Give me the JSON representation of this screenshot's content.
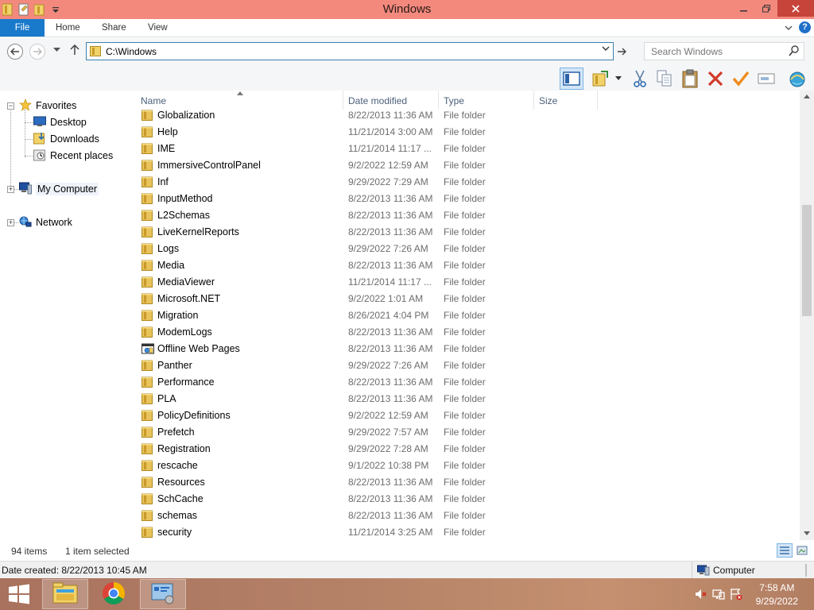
{
  "window": {
    "title": "Windows"
  },
  "ribbon": {
    "tabs": [
      "File",
      "Home",
      "Share",
      "View"
    ]
  },
  "address": {
    "path": "C:\\Windows",
    "search_placeholder": "Search Windows"
  },
  "nav_pane": {
    "favorites": "Favorites",
    "desktop": "Desktop",
    "downloads": "Downloads",
    "recent": "Recent places",
    "computer": "My Computer",
    "network": "Network"
  },
  "columns": {
    "name": "Name",
    "date": "Date modified",
    "type": "Type",
    "size": "Size"
  },
  "files": [
    {
      "name": "Globalization",
      "date": "8/22/2013 11:36 AM",
      "type": "File folder",
      "icon": "folder-icon"
    },
    {
      "name": "Help",
      "date": "11/21/2014 3:00 AM",
      "type": "File folder",
      "icon": "folder-icon"
    },
    {
      "name": "IME",
      "date": "11/21/2014 11:17 ...",
      "type": "File folder",
      "icon": "folder-icon"
    },
    {
      "name": "ImmersiveControlPanel",
      "date": "9/2/2022 12:59 AM",
      "type": "File folder",
      "icon": "folder-icon"
    },
    {
      "name": "Inf",
      "date": "9/29/2022 7:29 AM",
      "type": "File folder",
      "icon": "folder-icon"
    },
    {
      "name": "InputMethod",
      "date": "8/22/2013 11:36 AM",
      "type": "File folder",
      "icon": "folder-icon"
    },
    {
      "name": "L2Schemas",
      "date": "8/22/2013 11:36 AM",
      "type": "File folder",
      "icon": "folder-icon"
    },
    {
      "name": "LiveKernelReports",
      "date": "8/22/2013 11:36 AM",
      "type": "File folder",
      "icon": "folder-icon"
    },
    {
      "name": "Logs",
      "date": "9/29/2022 7:26 AM",
      "type": "File folder",
      "icon": "folder-icon"
    },
    {
      "name": "Media",
      "date": "8/22/2013 11:36 AM",
      "type": "File folder",
      "icon": "folder-icon"
    },
    {
      "name": "MediaViewer",
      "date": "11/21/2014 11:17 ...",
      "type": "File folder",
      "icon": "folder-icon"
    },
    {
      "name": "Microsoft.NET",
      "date": "9/2/2022 1:01 AM",
      "type": "File folder",
      "icon": "folder-icon"
    },
    {
      "name": "Migration",
      "date": "8/26/2021 4:04 PM",
      "type": "File folder",
      "icon": "folder-icon"
    },
    {
      "name": "ModemLogs",
      "date": "8/22/2013 11:36 AM",
      "type": "File folder",
      "icon": "folder-icon"
    },
    {
      "name": "Offline Web Pages",
      "date": "8/22/2013 11:36 AM",
      "type": "File folder",
      "icon": "offline-web-pages-icon"
    },
    {
      "name": "Panther",
      "date": "9/29/2022 7:26 AM",
      "type": "File folder",
      "icon": "folder-icon"
    },
    {
      "name": "Performance",
      "date": "8/22/2013 11:36 AM",
      "type": "File folder",
      "icon": "folder-icon"
    },
    {
      "name": "PLA",
      "date": "8/22/2013 11:36 AM",
      "type": "File folder",
      "icon": "folder-icon"
    },
    {
      "name": "PolicyDefinitions",
      "date": "9/2/2022 12:59 AM",
      "type": "File folder",
      "icon": "folder-icon"
    },
    {
      "name": "Prefetch",
      "date": "9/29/2022 7:57 AM",
      "type": "File folder",
      "icon": "folder-icon"
    },
    {
      "name": "Registration",
      "date": "9/29/2022 7:28 AM",
      "type": "File folder",
      "icon": "folder-icon"
    },
    {
      "name": "rescache",
      "date": "9/1/2022 10:38 PM",
      "type": "File folder",
      "icon": "folder-icon"
    },
    {
      "name": "Resources",
      "date": "8/22/2013 11:36 AM",
      "type": "File folder",
      "icon": "folder-icon"
    },
    {
      "name": "SchCache",
      "date": "8/22/2013 11:36 AM",
      "type": "File folder",
      "icon": "folder-icon"
    },
    {
      "name": "schemas",
      "date": "8/22/2013 11:36 AM",
      "type": "File folder",
      "icon": "folder-icon"
    },
    {
      "name": "security",
      "date": "11/21/2014 3:25 AM",
      "type": "File folder",
      "icon": "folder-icon"
    }
  ],
  "status": {
    "item_count": "94 items",
    "selected": "1 item selected"
  },
  "details": {
    "date_created": "Date created: 8/22/2013 10:45 AM",
    "location": "Computer"
  },
  "taskbar": {
    "time": "7:58 AM",
    "date": "9/29/2022"
  },
  "colors": {
    "title_bar": "#f3897d",
    "file_tab": "#1979ca",
    "close_button": "#c7443a",
    "folder": "#e8c25a"
  }
}
